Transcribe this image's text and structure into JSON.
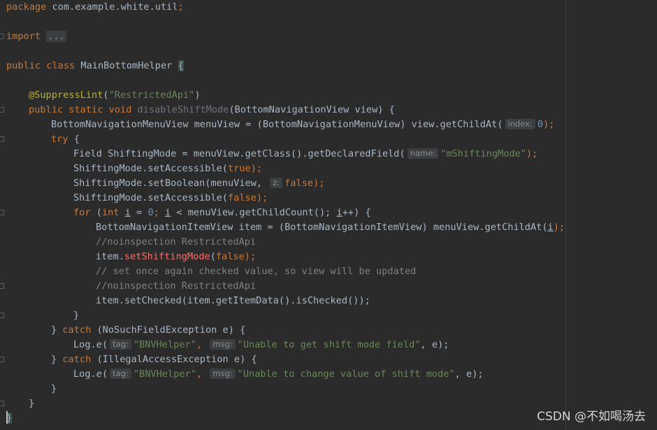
{
  "code": {
    "l1_pkg_kw": "package",
    "l1_pkg_name": " com.example.white.util",
    "l1_semi": ";",
    "l3_import_kw": "import",
    "l3_collapsed": "...",
    "l5_public": "public",
    "l5_class": "class",
    "l5_name": " MainBottomHelper ",
    "l5_brace": "{",
    "l7_annotation": "@SuppressLint",
    "l7_paren_open": "(",
    "l7_value": "\"RestrictedApi\"",
    "l7_paren_close": ")",
    "l8_public": "public",
    "l8_static": "static",
    "l8_void": "void",
    "l8_method": "disableShiftMode",
    "l8_params": "(BottomNavigationView view) {",
    "l9_decl": "BottomNavigationMenuView menuView = (BottomNavigationMenuView) view.getChildAt(",
    "l9_hint": "index:",
    "l9_num": "0",
    "l9_end": ");",
    "l10_try": "try",
    "l10_brace": " {",
    "l11_decl": "Field ShiftingMode = menuView.getClass().getDeclaredField(",
    "l11_hint": "name:",
    "l11_str": "\"mShiftingMode\"",
    "l11_end": ");",
    "l12_call": "ShiftingMode.setAccessible(",
    "l12_true": "true",
    "l12_end": ");",
    "l13_call": "ShiftingMode.setBoolean(menuView,",
    "l13_hint": "z:",
    "l13_false": "false",
    "l13_end": ");",
    "l14_call": "ShiftingMode.setAccessible(",
    "l14_false": "false",
    "l14_end": ");",
    "l15_for": "for",
    "l15_open": " (",
    "l15_int": "int",
    "l15_var_i1": "i",
    "l15_eq": " = ",
    "l15_zero": "0",
    "l15_semi1": "; ",
    "l15_var_i2": "i",
    "l15_cond": " < menuView.getChildCount(); ",
    "l15_var_i3": "i",
    "l15_end": "++) {",
    "l16_decl": "BottomNavigationItemView item = (BottomNavigationItemView) menuView.getChildAt(",
    "l16_var_i": "i",
    "l16_end": ");",
    "l17_comment": "//noinspection RestrictedApi",
    "l18_item": "item.",
    "l18_method": "setShiftingMode",
    "l18_paren": "(",
    "l18_false": "false",
    "l18_end": ");",
    "l19_comment": "// set once again checked value, so view will be updated",
    "l20_comment": "//noinspection RestrictedApi",
    "l21_call": "item.setChecked(item.getItemData().isChecked());",
    "l22_brace": "}",
    "l23_close": "} ",
    "l23_catch": "catch",
    "l23_exc": " (NoSuchFieldException e) {",
    "l24_log": "Log.",
    "l24_e": "e",
    "l24_paren": "(",
    "l24_hint_tag": "tag:",
    "l24_tag": "\"BNVHelper\"",
    "l24_comma": ",",
    "l24_hint_msg": "msg:",
    "l24_msg": "\"Unable to get shift mode field\"",
    "l24_end": ", e);",
    "l25_close": "} ",
    "l25_catch": "catch",
    "l25_exc": " (IllegalAccessException e) {",
    "l26_log": "Log.",
    "l26_e": "e",
    "l26_paren": "(",
    "l26_hint_tag": "tag:",
    "l26_tag": "\"BNVHelper\"",
    "l26_comma": ",",
    "l26_hint_msg": "msg:",
    "l26_msg": "\"Unable to change value of shift mode\"",
    "l26_end": ", e);",
    "l27_brace": "}",
    "l28_brace": "}",
    "l29_brace": "}"
  },
  "watermark": "CSDN @不如喝汤去",
  "colors": {
    "background": "#2b2b2b",
    "keyword": "#cc7832",
    "string": "#6a8759",
    "number": "#6897bb",
    "annotation": "#bbb529",
    "comment": "#808080",
    "method": "#ffc66d",
    "error_method": "#ff6b68",
    "default_text": "#a9b7c6"
  }
}
